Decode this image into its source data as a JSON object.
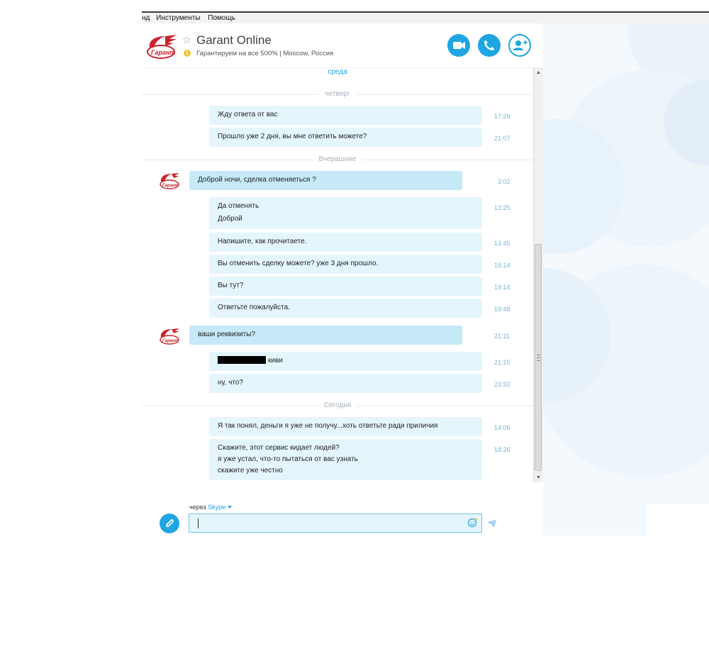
{
  "menu": {
    "items": [
      "нд",
      "Инструменты",
      "Помощь"
    ]
  },
  "header": {
    "title": "Garant Online",
    "mood": "Гарантируем на все 500% | Moscow, Россия",
    "logo_text": "Гарант"
  },
  "colors": {
    "accent": "#1fa5e2",
    "bubble_out": "#e5f5fc",
    "bubble_in": "#c6e9f7",
    "time": "#7cb4cc"
  },
  "chat": {
    "top_day": "среда",
    "separators": [
      "четверг",
      "Вчерашние",
      "Сегодня"
    ],
    "messages": [
      {
        "text": "Жду ответа от вас",
        "time": "17:29"
      },
      {
        "text": "Прошло уже 2 дня, вы мне ответить можете?",
        "time": "21:07"
      },
      {
        "text": "Доброй ночи, сделка отменяеться ?",
        "time": "3:02"
      },
      {
        "lines": [
          "Да отменять",
          "Доброй"
        ],
        "time": "13:25"
      },
      {
        "text": "Напишите, как прочитаете.",
        "time": "13:45"
      },
      {
        "text": "Вы отменить сделку можете? уже 3 дня прошло.",
        "time": "16:14"
      },
      {
        "text": "Вы тут?",
        "time": "19:14"
      },
      {
        "text": "Ответьте пожалуйста.",
        "time": "19:48"
      },
      {
        "text": "ваши реквизиты?",
        "time": "21:11"
      },
      {
        "text": "киви",
        "time": "21:15"
      },
      {
        "text": "ну, что?",
        "time": "23:32"
      },
      {
        "text": "Я так понял, деньги я уже не получу...хоть ответьте ради приличия",
        "time": "14:06"
      },
      {
        "lines": [
          "Скажите, этот сервис кидает людей?",
          "я уже устал, что-то пытаться от вас узнать",
          "скажите уже честно"
        ],
        "time": "18:26"
      }
    ]
  },
  "composer": {
    "via_label": "через",
    "via_service": "Skype",
    "input_value": ""
  }
}
